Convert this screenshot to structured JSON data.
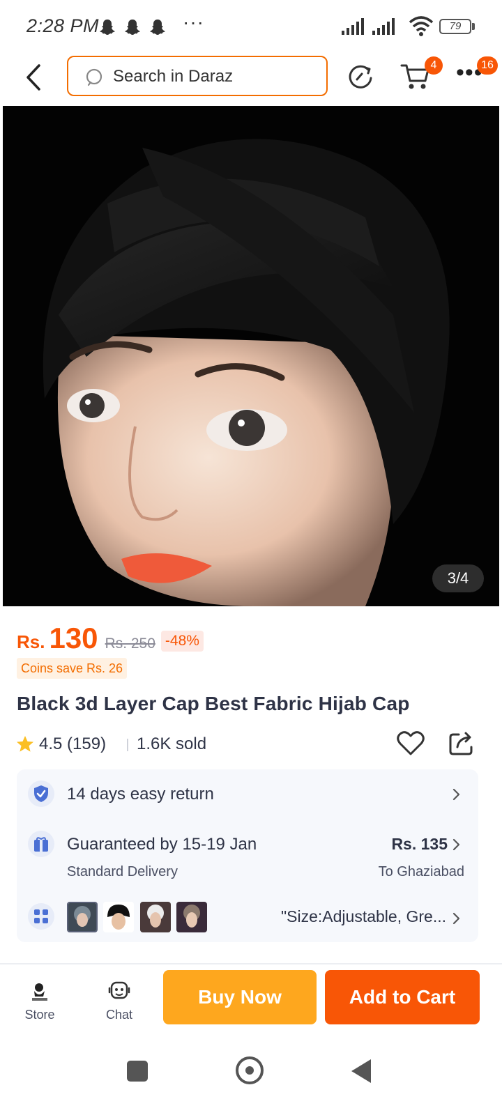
{
  "status_bar": {
    "time": "2:28 PM",
    "overflow": "···",
    "battery": "79",
    "icons": [
      "snapchat-icon",
      "snapchat-icon",
      "snapchat-icon",
      "signal-icon",
      "signal-icon",
      "wifi-icon",
      "battery-icon"
    ]
  },
  "header": {
    "search_placeholder": "Search in Daraz",
    "cart_count": "4",
    "more_count": "16",
    "icons": [
      "back-arrow-icon",
      "search-icon",
      "history-icon",
      "cart-icon",
      "more-icon"
    ]
  },
  "gallery": {
    "counter": "3/4",
    "current": 3,
    "total": 4
  },
  "product": {
    "currency": "Rs.",
    "price": "130",
    "original_price": "Rs. 250",
    "discount": "-48%",
    "coins": "Coins save Rs. 26",
    "title": "Black 3d Layer Cap Best Fabric Hijab Cap",
    "rating": "4.5 (159)",
    "sold": "1.6K sold"
  },
  "info": {
    "return_policy": "14 days easy return",
    "delivery_title": "Guaranteed by 15-19 Jan",
    "delivery_type": "Standard Delivery",
    "shipping_price": "Rs. 135",
    "shipping_to": "To Ghaziabad",
    "variant": "\"Size:Adjustable, Gre..."
  },
  "bottom_bar": {
    "store_label": "Store",
    "chat_label": "Chat",
    "buy_now": "Buy Now",
    "add_to_cart": "Add to Cart"
  },
  "colors": {
    "brand_orange": "#f85606",
    "buy_now_yellow": "#fea71e",
    "text_dark": "#2e3346"
  }
}
